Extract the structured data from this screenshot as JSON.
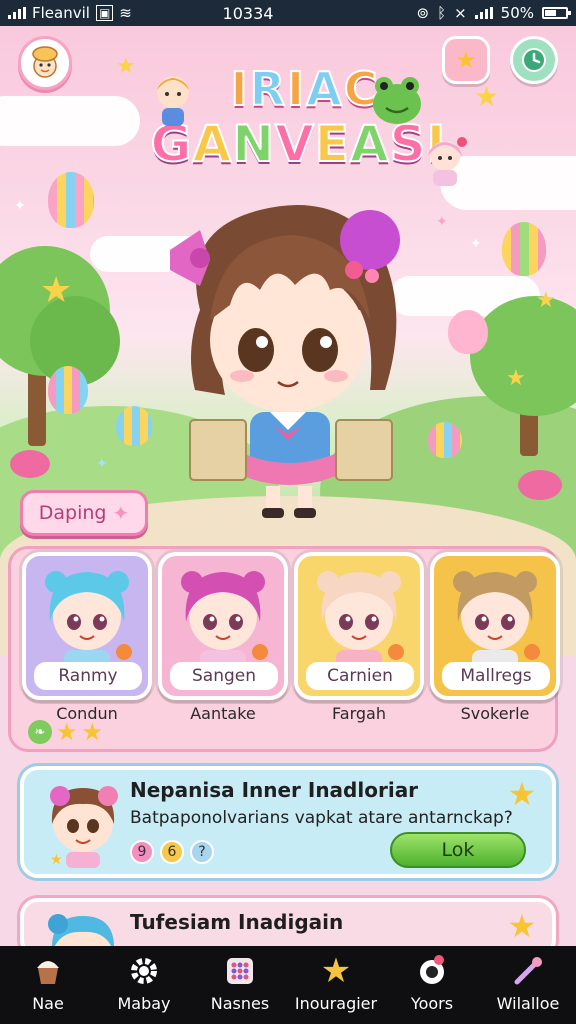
{
  "status_bar": {
    "carrier": "Fleanvil",
    "time": "10334",
    "battery": "50%"
  },
  "title": {
    "line1": [
      "I",
      "R",
      "I",
      "A",
      "C"
    ],
    "line2": [
      "G",
      "A",
      "N",
      "V",
      "E",
      "A",
      "S",
      "L"
    ]
  },
  "top_buttons": {
    "star_color": "#f9c431",
    "clock_color": "#7fd0a2"
  },
  "tag_pill": {
    "label": "Daping",
    "icon": "sparkle-icon"
  },
  "roster": [
    {
      "name": "Ranmy",
      "label": "Condun",
      "bg": "#c8b6f0",
      "hair": "#5cc9e9",
      "shirt": "#9bd6f2"
    },
    {
      "name": "Sangen",
      "label": "Aantake",
      "bg": "#f6b6d3",
      "hair": "#d34fb1",
      "shirt": "#f6c0e0"
    },
    {
      "name": "Carnien",
      "label": "Fargah",
      "bg": "#f9d66c",
      "hair": "#f7d6c3",
      "shirt": "#f8b2c4"
    },
    {
      "name": "Mallregs",
      "label": "Svokerle",
      "bg": "#f6c34a",
      "hair": "#c29b62",
      "shirt": "#eaeaea"
    }
  ],
  "missions": [
    {
      "title": "Nepanisa Inner Inadloriar",
      "desc": "Batpaponolvarians vapkat atare antarnckap?",
      "button": "Lok",
      "pills": [
        "9",
        "6",
        "?"
      ]
    },
    {
      "title": "Tufesiam Inadigain"
    }
  ],
  "nav": [
    {
      "label": "Nae",
      "icon": "cupcake-icon"
    },
    {
      "label": "Mabay",
      "icon": "gear-icon"
    },
    {
      "label": "Nasnes",
      "icon": "grid-icon"
    },
    {
      "label": "Inouragier",
      "icon": "star-icon"
    },
    {
      "label": "Yoors",
      "icon": "avatar-icon"
    },
    {
      "label": "Wilalloe",
      "icon": "wand-icon"
    }
  ]
}
